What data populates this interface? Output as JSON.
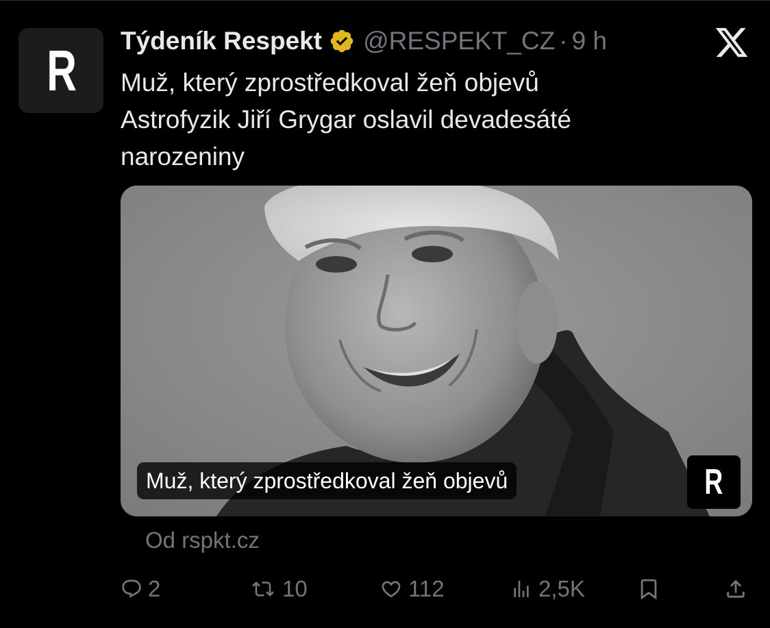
{
  "author": {
    "avatar_letter": "R",
    "display_name": "Týdeník Respekt",
    "verified_icon": "verified-gold-badge",
    "handle": "@RESPEKT_CZ",
    "separator": "·",
    "time": "9 h"
  },
  "platform_logo": "x-logo",
  "tweet": {
    "lines": [
      "Muž, který zprostředkoval žeň objevů",
      "Astrofyzik Jiří Grygar oslavil devadesáté",
      "narozeniny"
    ]
  },
  "card": {
    "image_description": "black-and-white portrait photo",
    "caption": "Muž, který zprostředkoval žeň objevů",
    "logo_letter": "R"
  },
  "source": "Od rspkt.cz",
  "actions": {
    "reply": {
      "icon": "reply-icon",
      "count": "2"
    },
    "repost": {
      "icon": "repost-icon",
      "count": "10"
    },
    "like": {
      "icon": "heart-icon",
      "count": "112"
    },
    "views": {
      "icon": "views-icon",
      "count": "2,5K"
    },
    "bookmark": {
      "icon": "bookmark-icon"
    },
    "share": {
      "icon": "share-icon"
    }
  },
  "colors": {
    "background": "#000000",
    "text_primary": "#e7e9ea",
    "text_secondary": "#71767b",
    "verified_gold": "#e2b719"
  }
}
